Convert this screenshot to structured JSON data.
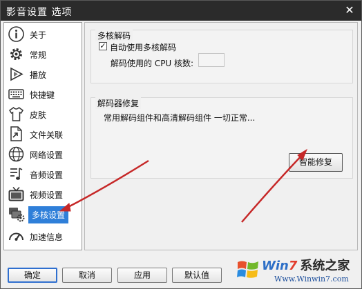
{
  "window": {
    "title": "影音设置 选项",
    "close_symbol": "✕"
  },
  "sidebar": {
    "items": [
      {
        "label": "关于",
        "icon": "info-icon"
      },
      {
        "label": "常规",
        "icon": "gear-icon"
      },
      {
        "label": "播放",
        "icon": "play-icon"
      },
      {
        "label": "快捷键",
        "icon": "keyboard-icon"
      },
      {
        "label": "皮肤",
        "icon": "shirt-icon"
      },
      {
        "label": "文件关联",
        "icon": "file-link-icon"
      },
      {
        "label": "网络设置",
        "icon": "globe-icon"
      },
      {
        "label": "音频设置",
        "icon": "audio-icon"
      },
      {
        "label": "视频设置",
        "icon": "tv-icon"
      },
      {
        "label": "多核设置",
        "icon": "multicore-icon",
        "selected": true
      },
      {
        "label": "加速信息",
        "icon": "speedometer-icon"
      }
    ],
    "selected_color": "#2f7fd9"
  },
  "multicore": {
    "group_title": "多核解码",
    "auto_checkbox_label": "自动使用多核解码",
    "auto_checked": true,
    "check_mark": "✓",
    "cores_label": "解码使用的 CPU 核数:",
    "cores_value": ""
  },
  "repair": {
    "group_title": "解码器修复",
    "status_text": "常用解码组件和高清解码组件 一切正常...",
    "repair_button": "智能修复"
  },
  "buttons": {
    "ok": "确定",
    "cancel": "取消",
    "apply": "应用",
    "default": "默认值"
  },
  "watermark": {
    "brand_win": "Win",
    "brand_seven": "7",
    "brand_cn": "系统之家",
    "url": "Www.Winwin7.com"
  },
  "annotation": {
    "arrow_color": "#c62828"
  }
}
